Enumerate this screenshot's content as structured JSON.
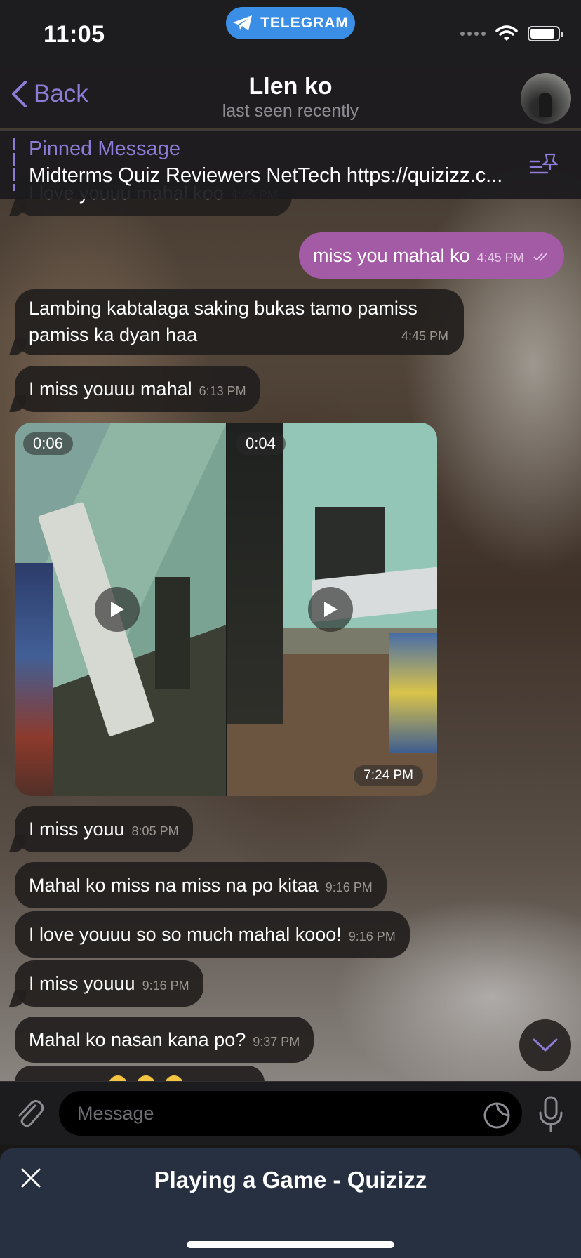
{
  "status_bar": {
    "time": "11:05",
    "app_pill": "TELEGRAM",
    "battery_level": 0.9
  },
  "nav": {
    "back_label": "Back",
    "title": "Llen ko",
    "subtitle": "last seen recently"
  },
  "pinned": {
    "title": "Pinned Message",
    "text": "Midterms Quiz Reviewers NetTech https://quizizz.c..."
  },
  "messages": {
    "m0": {
      "text": "I love youuu mahal koo",
      "time": "4:45 PM"
    },
    "m1": {
      "text": "miss you mahal ko",
      "time": "4:45 PM"
    },
    "m2": {
      "text": "Lambing kabtalaga saking bukas tamo pamiss pamiss ka dyan haa",
      "time": "4:45 PM"
    },
    "m3": {
      "text": "I miss youuu mahal",
      "time": "6:13 PM"
    },
    "media": {
      "duration_left": "0:06",
      "duration_right": "0:04",
      "time": "7:24 PM"
    },
    "m4": {
      "text": "I miss youu",
      "time": "8:05 PM"
    },
    "m5": {
      "text": "Mahal ko miss na miss na po kitaa",
      "time": "9:16 PM"
    },
    "m6": {
      "text": "I love youuu so so much mahal kooo!",
      "time": "9:16 PM"
    },
    "m7": {
      "text": "I miss youuu",
      "time": "9:16 PM"
    },
    "m8": {
      "text": "Mahal ko nasan kana po?",
      "time": "9:37 PM"
    }
  },
  "input": {
    "placeholder": "Message"
  },
  "bottom_panel": {
    "title": "Playing a Game - Quizizz"
  },
  "colors": {
    "accent": "#8e7bd6",
    "outgoing_bubble": "#a45ba6",
    "telegram_blue": "#3a8ee6",
    "panel": "#263040"
  }
}
